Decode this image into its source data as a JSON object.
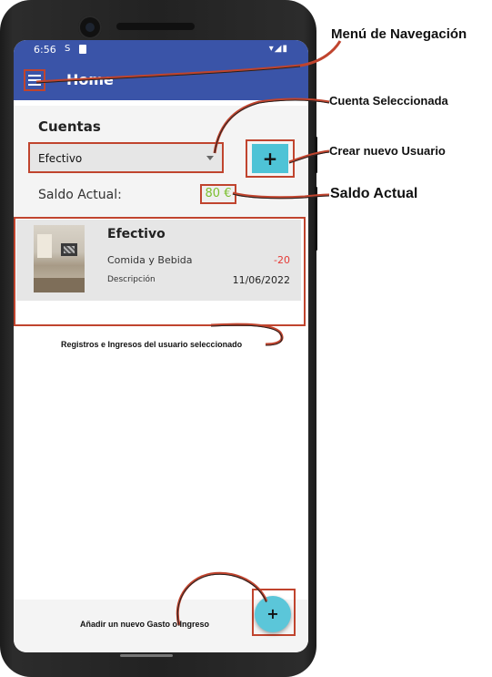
{
  "status_bar": {
    "time": "6:56",
    "sync_glyph": "S",
    "right_icons": "▾◢▮"
  },
  "app_bar": {
    "title": "Home",
    "menu_icon": "hamburger-icon"
  },
  "accounts": {
    "label": "Cuentas",
    "selected": "Efectivo",
    "add_button": "+"
  },
  "balance": {
    "label": "Saldo Actual:",
    "value": "80 €",
    "value_color": "#7bbf2e"
  },
  "records": [
    {
      "title": "Efectivo",
      "category": "Comida y Bebida",
      "amount": "-20",
      "description": "Descripción",
      "date": "11/06/2022"
    }
  ],
  "fab": {
    "label": "+"
  },
  "annotations": {
    "menu": "Menú de Navegación",
    "selected_account": "Cuenta Seleccionada",
    "new_user": "Crear nuevo Usuario",
    "balance": "Saldo Actual",
    "records": "Registros e Ingresos del usuario seleccionado",
    "new_entry": "Añadir un nuevo Gasto o Ingreso"
  },
  "colors": {
    "app_bar": "#3a54a8",
    "highlight_frame": "#c0442e",
    "accent": "#4ec3d6",
    "negative_amount": "#e53935"
  }
}
